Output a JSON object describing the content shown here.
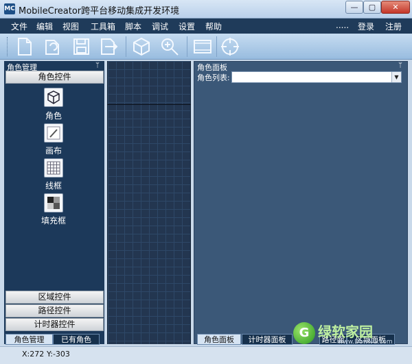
{
  "window": {
    "title": "MobileCreator跨平台移动集成开发环境",
    "icon_text": "MC"
  },
  "window_controls": {
    "minimize": "—",
    "maximize": "▢",
    "close": "✕"
  },
  "menubar": {
    "items": [
      "文件",
      "编辑",
      "视图",
      "工具箱",
      "脚本",
      "调试",
      "设置",
      "帮助"
    ],
    "more": ".....",
    "login": "登录",
    "register": "注册"
  },
  "toolbar": {
    "icons": [
      "new-file-icon",
      "open-icon",
      "save-icon",
      "export-icon",
      "cube-icon",
      "zoom-icon",
      "filmstrip-icon",
      "crosshair-icon"
    ]
  },
  "left_panel": {
    "title": "角色管理",
    "pin": "ᛘ",
    "sections": {
      "role_controls": "角色控件",
      "area_controls": "区域控件",
      "path_controls": "路径控件",
      "timer_controls": "计时器控件"
    },
    "tools": [
      {
        "label": "角色",
        "icon": "cube-icon"
      },
      {
        "label": "画布",
        "icon": "canvas-brush-icon"
      },
      {
        "label": "线框",
        "icon": "wireframe-grid-icon"
      },
      {
        "label": "填充框",
        "icon": "fill-box-icon"
      }
    ],
    "tabs": [
      "角色管理",
      "已有角色"
    ]
  },
  "right_panel": {
    "title": "角色面板",
    "pin": "ᛘ",
    "role_list_label": "角色列表:",
    "role_list_value": "",
    "tabs": [
      "角色面板",
      "计时器面板",
      "路径面板",
      "区域面板"
    ]
  },
  "statusbar": {
    "x": "X:272",
    "y": "Y:-303"
  },
  "watermark": {
    "brand": "绿软家园",
    "url": "www.DowNG.com"
  },
  "colors": {
    "panel_bg": "#1c395a",
    "right_panel_bg": "#3b5878",
    "menubar_bg": "#1f3b5a"
  }
}
